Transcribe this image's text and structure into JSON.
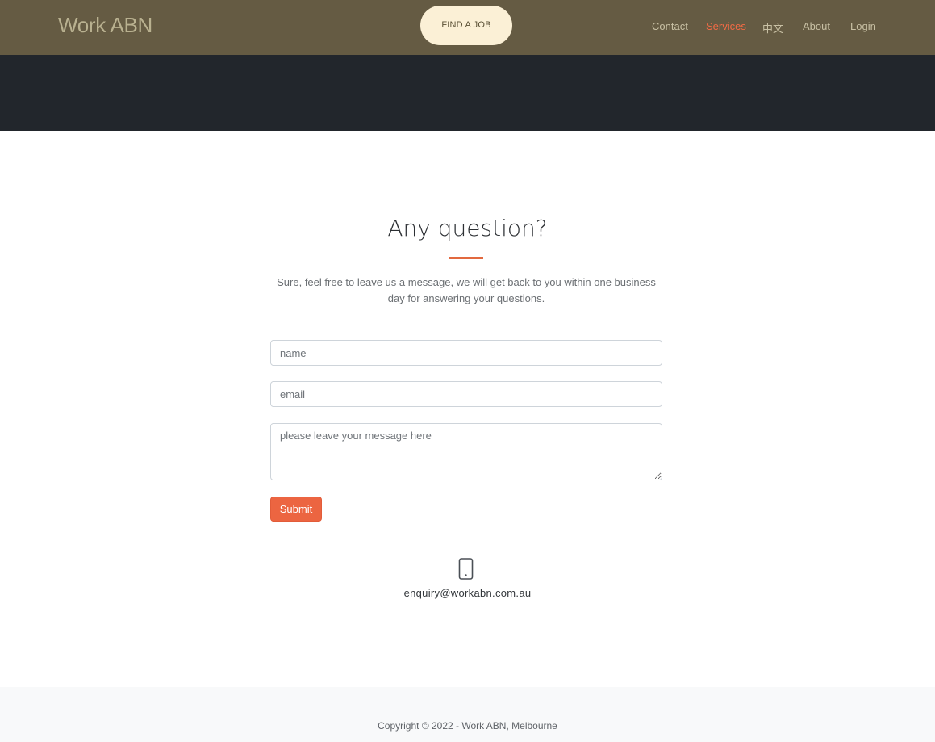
{
  "navbar": {
    "brand": "Work ABN",
    "cta_label": "FIND A JOB",
    "links": [
      {
        "label": "Contact",
        "active": false
      },
      {
        "label": "Services",
        "active": true
      },
      {
        "label": "中文",
        "active": false
      },
      {
        "label": "About",
        "active": false
      },
      {
        "label": "Login",
        "active": false
      }
    ]
  },
  "contact": {
    "title": "Any question?",
    "lead": "Sure, feel free to leave us a message, we will get back to you within one business day for answering your questions.",
    "name_placeholder": "name",
    "email_placeholder": "email",
    "message_placeholder": "please leave your message here",
    "submit_label": "Submit",
    "phone_icon": "mobile-phone-icon",
    "email_address": "enquiry@workabn.com.au"
  },
  "footer": {
    "copyright": "Copyright © 2022 - Work ABN, Melbourne"
  },
  "colors": {
    "navbar_bg": "#655b43",
    "hero_bg": "#22262c",
    "accent": "#ec6541",
    "cta_bg": "#fbf0d6"
  }
}
